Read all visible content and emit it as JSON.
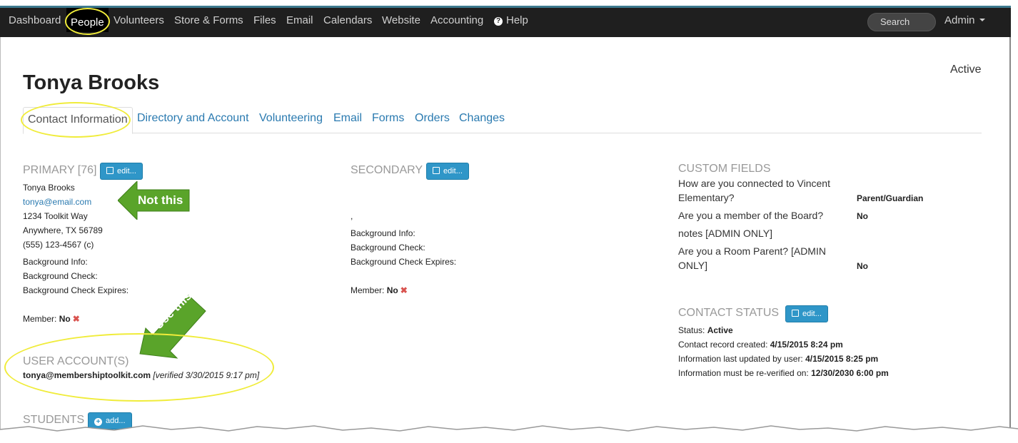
{
  "nav": {
    "items": [
      "Dashboard",
      "People",
      "Volunteers",
      "Store & Forms",
      "Files",
      "Email",
      "Calendars",
      "Website",
      "Accounting",
      "Help"
    ],
    "search_placeholder": "Search",
    "admin_label": "Admin"
  },
  "page": {
    "title": "Tonya Brooks",
    "status": "Active"
  },
  "tabs": [
    "Contact Information",
    "Directory and Account",
    "Volunteering",
    "Email",
    "Forms",
    "Orders",
    "Changes"
  ],
  "primary": {
    "heading": "PRIMARY [76]",
    "edit_label": "edit...",
    "name": "Tonya Brooks",
    "email": "tonya@email.com",
    "address1": "1234 Toolkit Way",
    "address2": "Anywhere, TX 56789",
    "phone": "(555) 123-4567 (c)",
    "bg_info": "Background Info:",
    "bg_check": "Background Check:",
    "bg_expires": "Background Check Expires:",
    "member_label": "Member:",
    "member_value": "No",
    "x": "✖"
  },
  "secondary": {
    "heading": "SECONDARY",
    "edit_label": "edit...",
    "comma": ",",
    "bg_info": "Background Info:",
    "bg_check": "Background Check:",
    "bg_expires": "Background Check Expires:",
    "member_label": "Member:",
    "member_value": "No",
    "x": "✖"
  },
  "user_accounts": {
    "heading": "USER ACCOUNT(S)",
    "email": "tonya@membershiptoolkit.com",
    "verified": "[verified 3/30/2015 9:17 pm]"
  },
  "students": {
    "heading": "STUDENTS",
    "add_label": "add..."
  },
  "custom_fields": {
    "heading": "CUSTOM FIELDS",
    "items": [
      {
        "q": "How are you connected to Vincent Elementary?",
        "a": "Parent/Guardian"
      },
      {
        "q": "Are you a member of the Board?",
        "a": "No"
      },
      {
        "q": "notes [ADMIN ONLY]",
        "a": ""
      },
      {
        "q": "Are you a Room Parent? [ADMIN ONLY]",
        "a": "No"
      }
    ]
  },
  "contact_status": {
    "heading": "CONTACT STATUS",
    "edit_label": "edit...",
    "status_label": "Status:",
    "status_value": "Active",
    "created_label": "Contact record created:",
    "created_value": "4/15/2015 8:24 pm",
    "updated_label": "Information last updated by user:",
    "updated_value": "4/15/2015 8:25 pm",
    "reverify_label": "Information must be re-verified on:",
    "reverify_value": "12/30/2030 6:00 pm"
  },
  "annotations": {
    "not_this": "Not this",
    "use_this": "Use this",
    "highlight_color": "#f0ec3a",
    "arrow_color": "#5aa42a"
  }
}
